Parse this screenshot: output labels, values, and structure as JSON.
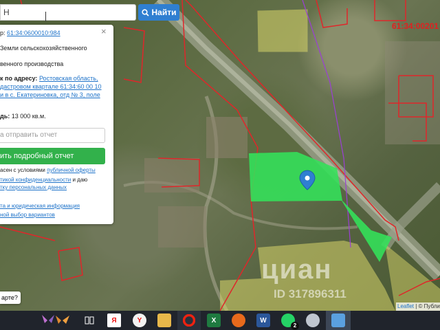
{
  "search": {
    "value": "Н",
    "button_label": "Найти"
  },
  "panel": {
    "cadastral_label": "р:",
    "cadastral_number": "61:34:0600010:984",
    "category_line1": "Земли сельскохозяйственного",
    "purpose_line": "венного производства",
    "address_label": "к по адресу:",
    "address_link_1": "Ростовская область,",
    "address_link_2": "дастровом квартале 61:34:60 00 10",
    "address_link_3": "и в с. Екатериновка, отд № 3, поле",
    "area_label": "дь:",
    "area_value": "13 000 кв.м.",
    "email_placeholder": "а отправить отчет",
    "report_button": "ить подробный отчет",
    "terms_1a": "асен с условиями ",
    "terms_1b": "публичной оферты",
    "terms_2a": "тикой конфиденциальности",
    "terms_2b": " и даю",
    "terms_3": "тку персональных данных",
    "info_1": "та и юридическая информация",
    "info_2": "ной выбор вариантов"
  },
  "bottom_question": "арте?",
  "map": {
    "cadastral_label": "61:34:00201",
    "watermark": "циан",
    "watermark_id": "ID 317896311",
    "attribution_leaflet": "Leaflet",
    "attribution_sep": " | © Публи",
    "parcel_color": "#33e35a",
    "boundary_color": "#e0262a",
    "neighbor_fill": "#d9d66a"
  },
  "taskbar": {
    "icons": [
      "butterfly-icon",
      "task-view-icon",
      "yandex-browser-icon",
      "yandex-icon",
      "file-explorer-icon",
      "opera-icon",
      "excel-icon",
      "firefox-icon",
      "word-icon",
      "whatsapp-icon",
      "app-icon",
      "image-viewer-icon"
    ],
    "whatsapp_badge": "2"
  }
}
